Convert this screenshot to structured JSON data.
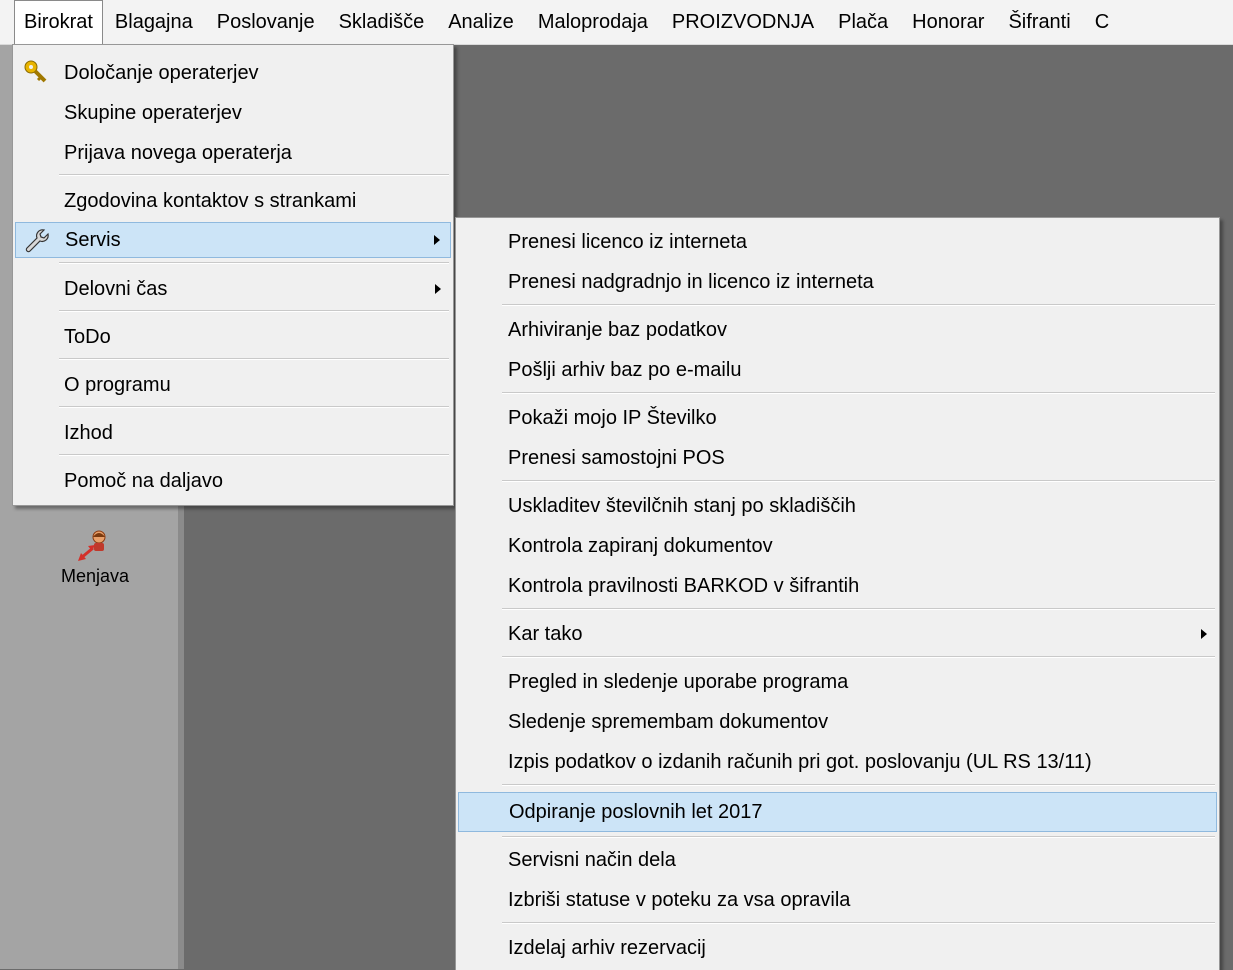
{
  "menubar": {
    "items": [
      {
        "label": "Birokrat"
      },
      {
        "label": "Blagajna"
      },
      {
        "label": "Poslovanje"
      },
      {
        "label": "Skladišče"
      },
      {
        "label": "Analize"
      },
      {
        "label": "Maloprodaja"
      },
      {
        "label": "PROIZVODNJA"
      },
      {
        "label": "Plača"
      },
      {
        "label": "Honorar"
      },
      {
        "label": "Šifranti"
      },
      {
        "label": "C"
      }
    ]
  },
  "sidebar": {
    "menjava_label": "Menjava"
  },
  "main_menu": {
    "items": [
      {
        "label": "Določanje operaterjev",
        "icon": "key-icon"
      },
      {
        "label": "Skupine operaterjev"
      },
      {
        "label": "Prijava novega operaterja"
      },
      {
        "label": "Zgodovina kontaktov s strankami"
      },
      {
        "label": "Servis",
        "icon": "wrench-icon",
        "submenu": true,
        "highlighted": true
      },
      {
        "label": "Delovni čas",
        "submenu": true
      },
      {
        "label": "ToDo"
      },
      {
        "label": "O programu"
      },
      {
        "label": "Izhod"
      },
      {
        "label": "Pomoč na daljavo"
      }
    ]
  },
  "servis_menu": {
    "items": [
      {
        "label": "Prenesi licenco iz interneta"
      },
      {
        "label": "Prenesi nadgradnjo in licenco iz interneta"
      },
      {
        "label": "Arhiviranje baz podatkov"
      },
      {
        "label": "Pošlji arhiv baz po e-mailu"
      },
      {
        "label": "Pokaži mojo IP Številko"
      },
      {
        "label": "Prenesi samostojni POS"
      },
      {
        "label": "Uskladitev številčnih stanj po skladiščih"
      },
      {
        "label": "Kontrola zapiranj dokumentov"
      },
      {
        "label": "Kontrola pravilnosti BARKOD v šifrantih"
      },
      {
        "label": "Kar tako",
        "submenu": true
      },
      {
        "label": "Pregled in sledenje uporabe programa"
      },
      {
        "label": "Sledenje spremembam dokumentov"
      },
      {
        "label": "Izpis podatkov o izdanih računih pri got. poslovanju (UL RS 13/11)"
      },
      {
        "label": "Odpiranje poslovnih let 2017",
        "highlighted": true
      },
      {
        "label": "Servisni način dela"
      },
      {
        "label": "Izbriši statuse v poteku za vsa opravila"
      },
      {
        "label": "Izdelaj arhiv rezervacij"
      }
    ]
  },
  "colors": {
    "highlight": "#cce4f7",
    "highlight_border": "#8fb9de",
    "menu_bg": "#f0f0f0",
    "workspace": "#6b6b6b",
    "sidebar": "#a4a4a4"
  }
}
